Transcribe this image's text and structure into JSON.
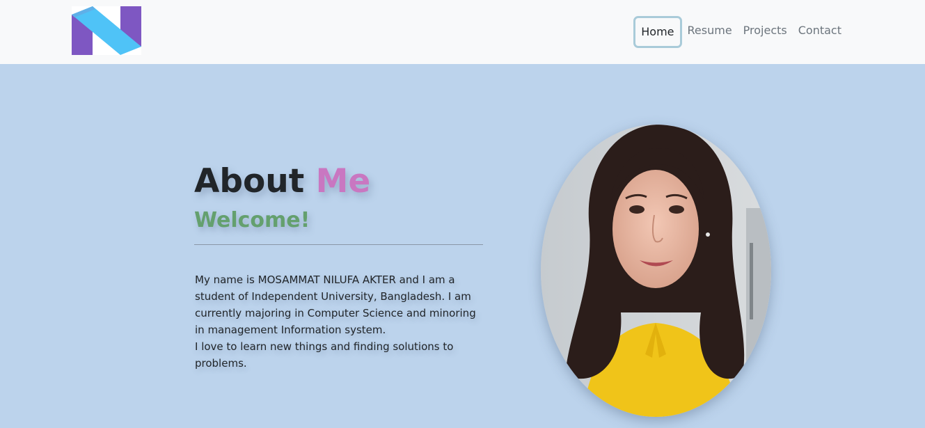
{
  "nav": {
    "logo_letter": "N",
    "links": [
      {
        "label": "Home",
        "active": true
      },
      {
        "label": "Resume",
        "active": false
      },
      {
        "label": "Projects",
        "active": false
      },
      {
        "label": "Contact",
        "active": false
      }
    ]
  },
  "hero": {
    "title_word": "About",
    "title_accent": "Me",
    "subtitle": "Welcome!",
    "bio_line1": "My name is MOSAMMAT NILUFA AKTER and I am a student of Independent University, Bangladesh. I am currently majoring in Computer Science and minoring in management Information system.",
    "bio_line2": "I love to learn new things and finding solutions to problems."
  },
  "colors": {
    "hero_background": "#bcd3ec",
    "navbar_background": "#f8f9fa",
    "title_accent": "#c977c1",
    "subtitle": "#64a06e",
    "active_nav_border": "#a9cbd9",
    "logo_purple": "#7e57c2",
    "logo_cyan": "#4fc3f7"
  },
  "icons": {
    "logo": "letter-n-logo-icon"
  }
}
